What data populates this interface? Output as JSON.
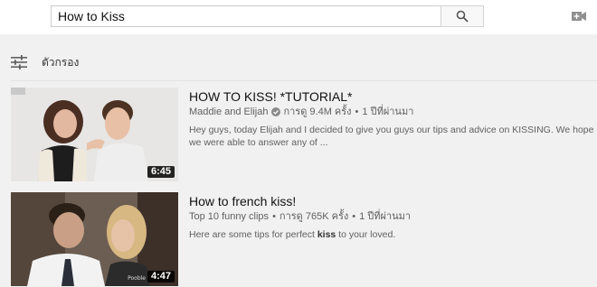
{
  "search": {
    "value": "How to Kiss"
  },
  "filter": {
    "label": "ตัวกรอง"
  },
  "results": [
    {
      "title": "HOW TO KISS! *TUTORIAL*",
      "channel": "Maddie and Elijah",
      "separator": "•",
      "views": "การดู 9.4M ครั้ง",
      "age": "1 ปีที่ผ่านมา",
      "duration": "6:45",
      "desc_before": "Hey guys, today Elijah and I decided to give you guys our tips and advice on KISSING. We hope we were able to answer any of ...",
      "desc_bold": "",
      "desc_after": ""
    },
    {
      "title": "How to french kiss!",
      "channel": "Top 10 funny clips",
      "separator": "•",
      "views": "การดู 765K ครั้ง",
      "age": "1 ปีที่ผ่านมา",
      "duration": "4:47",
      "watermark": "Pooble",
      "desc_before": "Here are some tips for perfect ",
      "desc_bold": "kiss",
      "desc_after": " to your loved."
    }
  ],
  "colors": {
    "duration_bg": "#000000",
    "meta_text": "#606060",
    "page_bg": "#f1f1f1"
  }
}
